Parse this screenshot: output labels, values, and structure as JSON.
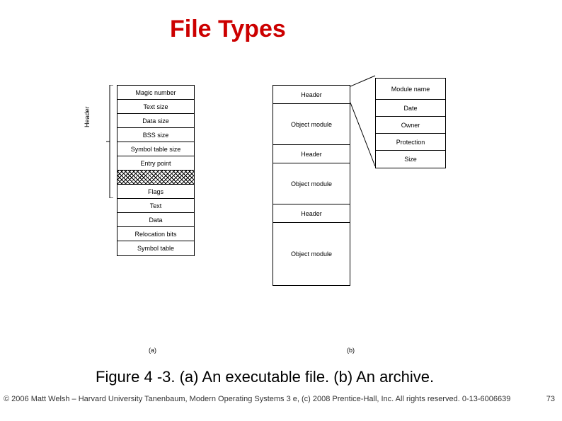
{
  "title": "File Types",
  "caption": "Figure 4 -3. (a) An executable file. (b) An archive.",
  "footer_left": "© 2006 Matt Welsh – Harvard University",
  "footer_mid": "Tanenbaum, Modern Operating Systems 3 e, (c) 2008 Prentice-Hall, Inc. All rights reserved. 0-13-6006639",
  "page_num": "73",
  "diagram": {
    "header_label": "Header",
    "sub_a": "(a)",
    "sub_b": "(b)",
    "col_a": [
      "Magic number",
      "Text size",
      "Data size",
      "BSS size",
      "Symbol table size",
      "Entry point",
      "",
      "Flags",
      "Text",
      "Data",
      "Relocation bits",
      "Symbol table"
    ],
    "col_b": [
      "Header",
      "Object module",
      "Header",
      "Object module",
      "Header",
      "Object module"
    ],
    "col_c": [
      "Module name",
      "Date",
      "Owner",
      "Protection",
      "Size"
    ]
  }
}
